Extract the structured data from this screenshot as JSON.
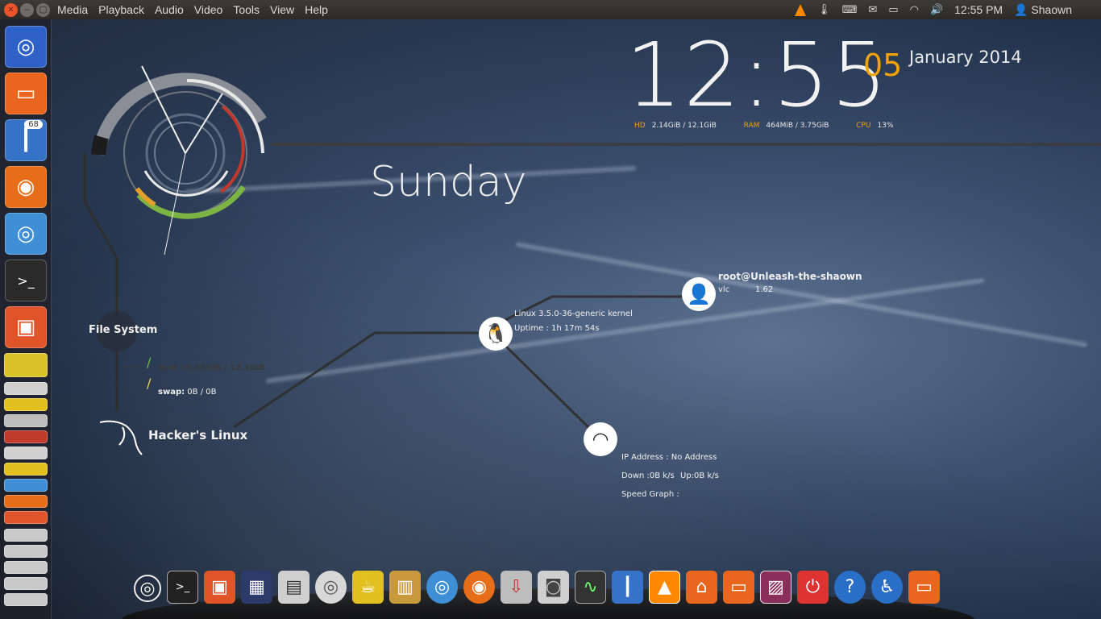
{
  "top_panel": {
    "window_controls": [
      "×",
      "–",
      "▢"
    ],
    "menus": [
      "Media",
      "Playback",
      "Audio",
      "Video",
      "Tools",
      "View",
      "Help"
    ],
    "clock": "12:55 PM",
    "user": "Shaown",
    "indicator_icons": [
      "vlc-icon",
      "thermometer-icon",
      "keyboard-icon",
      "mail-icon",
      "battery-icon",
      "wifi-icon",
      "volume-icon",
      "user-icon"
    ]
  },
  "launcher": {
    "items": [
      {
        "name": "ubuntu-dash",
        "icon": "◎",
        "bg": "#2f62c6"
      },
      {
        "name": "files",
        "icon": "▭",
        "bg": "#e8661e"
      },
      {
        "name": "thermometer",
        "icon": "┃",
        "bg": "#3673c8",
        "badge": "68"
      },
      {
        "name": "firefox",
        "icon": "◉",
        "bg": "#e76e18"
      },
      {
        "name": "chromium",
        "icon": "◎",
        "bg": "#3e8fd6"
      },
      {
        "name": "terminal",
        "icon": ">_",
        "bg": "#2a2a2a"
      },
      {
        "name": "software-center",
        "icon": "▣",
        "bg": "#e0542a"
      }
    ]
  },
  "clock_widget": {
    "time": "12:55",
    "day_num": "05",
    "month_year": "January 2014",
    "weekday": "Sunday"
  },
  "stats": {
    "hd_label": "HD",
    "hd_value": "2.14GiB / 12.1GiB",
    "ram_label": "RAM",
    "ram_value": "464MiB / 3.75GiB",
    "cpu_label": "CPU",
    "cpu_value": "13%"
  },
  "filesystem": {
    "title": "File System",
    "root": "root : 9.32GiB / 12.1GiB",
    "swap_label": "swap:",
    "swap_value": "0B / 0B",
    "distro": "Hacker's Linux"
  },
  "system": {
    "kernel": "Linux 3.5.0-36-generic kernel",
    "uptime": "Uptime : 1h 17m 54s"
  },
  "user_node": {
    "title": "root@Unleash-the-shaown",
    "proc": "vlc",
    "proc_value": "1.62"
  },
  "network": {
    "ip": "IP Address : No Address",
    "down": "Down :0B k/s",
    "up": "Up:0B k/s",
    "graph": "Speed Graph :"
  },
  "dock": {
    "items": [
      {
        "name": "ubuntu-icon",
        "glyph": "◎",
        "bg": "transparent"
      },
      {
        "name": "terminal-icon",
        "glyph": ">_",
        "bg": "#222"
      },
      {
        "name": "software-center-icon",
        "glyph": "▣",
        "bg": "#e0542a"
      },
      {
        "name": "workspaces-icon",
        "glyph": "▦",
        "bg": "#2c3a6a"
      },
      {
        "name": "calculator-icon",
        "glyph": "▤",
        "bg": "#cfcfcf"
      },
      {
        "name": "disc-icon",
        "glyph": "◎",
        "bg": "#d8d8d8"
      },
      {
        "name": "teapot-icon",
        "glyph": "☕",
        "bg": "#e2c020"
      },
      {
        "name": "book-icon",
        "glyph": "▥",
        "bg": "#c89a3c"
      },
      {
        "name": "chromium-icon",
        "glyph": "◎",
        "bg": "#3e8fd6"
      },
      {
        "name": "firefox-icon",
        "glyph": "◉",
        "bg": "#e76e18"
      },
      {
        "name": "transmission-icon",
        "glyph": "⇩",
        "bg": "#bdbdbd"
      },
      {
        "name": "camera-icon",
        "glyph": "◙",
        "bg": "#cfcfcf"
      },
      {
        "name": "system-monitor-icon",
        "glyph": "∿",
        "bg": "#333"
      },
      {
        "name": "thermometer-icon",
        "glyph": "┃",
        "bg": "#3673c8"
      },
      {
        "name": "vlc-icon",
        "glyph": "▲",
        "bg": "#ff8800"
      },
      {
        "name": "home-folder-icon",
        "glyph": "⌂",
        "bg": "#e8661e"
      },
      {
        "name": "documents-folder-icon",
        "glyph": "▭",
        "bg": "#e8661e"
      },
      {
        "name": "wallpaper-icon",
        "glyph": "▨",
        "bg": "#8a2f5c"
      },
      {
        "name": "power-icon",
        "glyph": "⏻",
        "bg": "#d33"
      },
      {
        "name": "help-icon",
        "glyph": "?",
        "bg": "#2a6fc7"
      },
      {
        "name": "accessibility-icon",
        "glyph": "♿",
        "bg": "#2a6fc7"
      },
      {
        "name": "trash-folder-icon",
        "glyph": "▭",
        "bg": "#e8661e"
      }
    ]
  }
}
